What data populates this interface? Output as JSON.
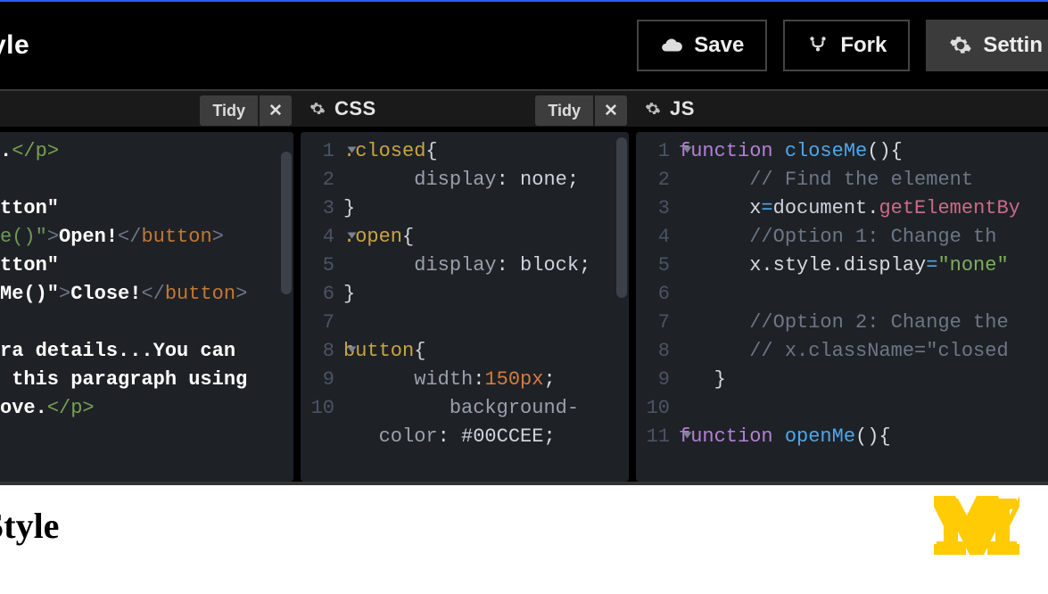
{
  "header": {
    "title_fragment": "yle",
    "buttons": {
      "save": "Save",
      "fork": "Fork",
      "settings": "Settin"
    }
  },
  "panels": {
    "html": {
      "tidy_label": "Tidy",
      "lines": [
        {
          "html": "<span class='h-txt'>.</span><span class='h-tag2'>&lt;/</span><span class='h-tag2'>p</span><span class='h-tag2'>&gt;</span>"
        },
        {
          "html": ""
        },
        {
          "html": "<span class='h-txt'>tton\"</span>"
        },
        {
          "html": "<span class='h-val'>e()\"</span><span class='h-tag'>&gt;</span><span class='h-txt'>Open!</span><span class='h-tag'>&lt;/</span><span class='h-name'>button</span><span class='h-tag'>&gt;</span>"
        },
        {
          "html": "<span class='h-txt'>tton\"</span>"
        },
        {
          "html": "<span class='h-txt'>Me()\"</span><span class='h-tag'>&gt;</span><span class='h-txt'>Close!</span><span class='h-tag'>&lt;/</span><span class='h-name'>button</span><span class='h-tag'>&gt;</span>"
        },
        {
          "html": ""
        },
        {
          "html": "<span class='h-txt'>ra details...You can</span>"
        },
        {
          "html": "<span class='h-txt'> this paragraph using</span>"
        },
        {
          "html": "<span class='h-txt'>ove.</span><span class='h-tag2'>&lt;/</span><span class='h-tag2'>p</span><span class='h-tag2'>&gt;</span>"
        }
      ]
    },
    "css": {
      "label": "CSS",
      "tidy_label": "Tidy",
      "lines": [
        {
          "n": 1,
          "fold": true,
          "html": "<span class='c-sel'>.closed</span><span class='c-punc'>{</span>"
        },
        {
          "n": 2,
          "html": "      <span class='c-prop'>display</span>: <span class='c-val'>none</span>;"
        },
        {
          "n": 3,
          "html": "<span class='c-punc'>}</span>"
        },
        {
          "n": 4,
          "fold": true,
          "html": "<span class='c-sel'>.open</span><span class='c-punc'>{</span>"
        },
        {
          "n": 5,
          "html": "      <span class='c-prop'>display</span>: <span class='c-val'>block</span>;"
        },
        {
          "n": 6,
          "html": "<span class='c-punc'>}</span>"
        },
        {
          "n": 7,
          "html": ""
        },
        {
          "n": 8,
          "fold": true,
          "html": "<span class='c-sel'>button</span><span class='c-punc'>{</span>"
        },
        {
          "n": 9,
          "html": "      <span class='c-prop'>width</span>:<span class='c-num'>150px</span>;"
        },
        {
          "n": 10,
          "html": "         <span class='c-prop'>background-</span>"
        },
        {
          "n": "",
          "html": "   <span class='c-prop'>color</span>: <span class='c-val'>#00CCEE</span>;"
        }
      ]
    },
    "js": {
      "label": "JS",
      "lines": [
        {
          "n": 1,
          "fold": true,
          "html": "<span class='c-kw'>function</span> <span class='c-fn'>closeMe</span>(){ "
        },
        {
          "n": 2,
          "html": "      <span class='c-cmt'>// Find the element</span>"
        },
        {
          "n": 3,
          "html": "      x<span class='c-op'>=</span><span class='c-obj'>document</span>.<span class='c-meth'>getElementBy</span>"
        },
        {
          "n": 4,
          "html": "      <span class='c-cmt'>//Option 1: Change th</span>"
        },
        {
          "n": 5,
          "html": "      x.style.display<span class='c-op'>=</span><span class='c-str'>\"none\"</span>"
        },
        {
          "n": 6,
          "html": ""
        },
        {
          "n": 7,
          "html": "      <span class='c-cmt'>//Option 2: Change the</span>"
        },
        {
          "n": 8,
          "html": "      <span class='c-cmt'>// x.className=\"closed</span>"
        },
        {
          "n": 9,
          "html": "   }"
        },
        {
          "n": 10,
          "html": ""
        },
        {
          "n": 11,
          "fold": true,
          "html": "<span class='c-kw'>function</span> <span class='c-fn'>openMe</span>(){ "
        }
      ]
    }
  },
  "result": {
    "heading_fragment": "Style"
  },
  "logo_color": "#ffcb05"
}
